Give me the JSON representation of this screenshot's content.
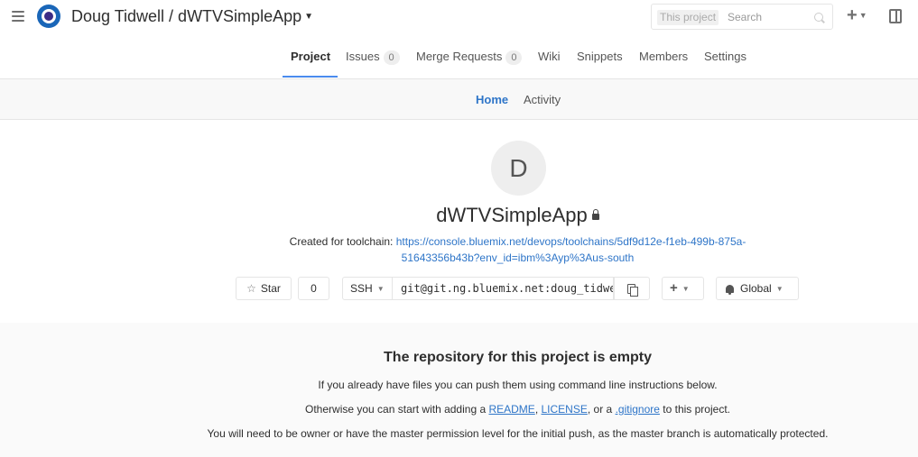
{
  "header": {
    "project_path": "Doug Tidwell / dWTVSimpleApp",
    "search_scope": "This project",
    "search_placeholder": "Search",
    "plus_symbol": "+"
  },
  "nav": {
    "tabs": [
      {
        "label": "Project",
        "active": true
      },
      {
        "label": "Issues",
        "count": "0"
      },
      {
        "label": "Merge Requests",
        "count": "0"
      },
      {
        "label": "Wiki"
      },
      {
        "label": "Snippets"
      },
      {
        "label": "Members"
      },
      {
        "label": "Settings"
      }
    ]
  },
  "subnav": {
    "home": "Home",
    "activity": "Activity"
  },
  "project": {
    "avatar_letter": "D",
    "name": "dWTVSimpleApp",
    "description_prefix": "Created for toolchain:",
    "toolchain_url_line1": "https://console.bluemix.net/devops/toolchains/5df9d12e-f1eb-499b-875a-",
    "toolchain_url_line2": "51643356b43b?env_id=ibm%3Ayp%3Aus-south"
  },
  "controls": {
    "star_label": "Star",
    "star_count": "0",
    "protocol": "SSH",
    "clone_url": "git@git.ng.bluemix.net:doug_tidwell/dWTVSimpleApp.git",
    "add_symbol": "+",
    "notification_level": "Global"
  },
  "empty_repo": {
    "title": "The repository for this project is empty",
    "line1": "If you already have files you can push them using command line instructions below.",
    "line2_prefix": "Otherwise you can start with adding a",
    "readme": "README",
    "sep1": ",",
    "license": "LICENSE",
    "sep2": ", or a",
    "gitignore": ".gitignore",
    "line2_suffix": "to this project.",
    "line3": "You will need to be owner or have the master permission level for the initial push, as the master branch is automatically protected."
  },
  "colors": {
    "accent": "#4a8bee",
    "link": "#2e75c8",
    "logo": "#1a66b8"
  }
}
